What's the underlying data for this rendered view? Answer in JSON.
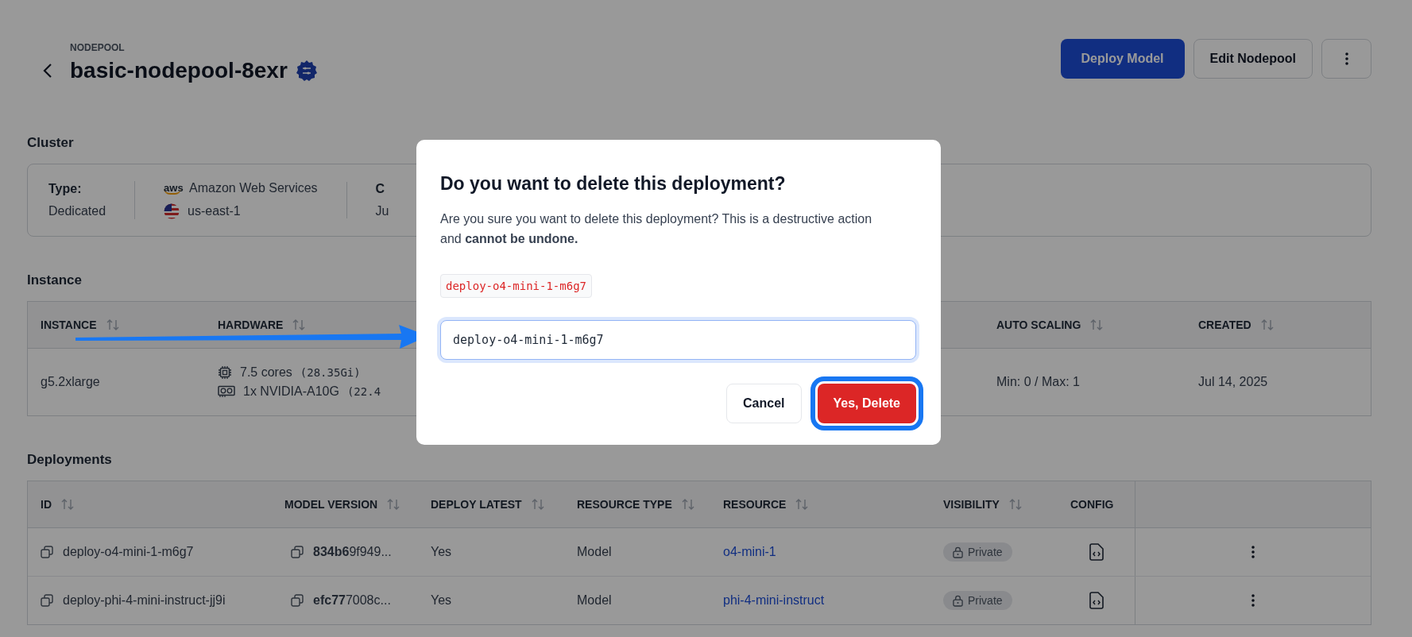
{
  "header": {
    "eyebrow": "NODEPOOL",
    "title": "basic-nodepool-8exr",
    "buttons": [
      {
        "label": "Deploy Model",
        "kind": "primary"
      },
      {
        "label": "Edit Nodepool",
        "kind": "secondary"
      }
    ]
  },
  "cluster": {
    "heading": "Cluster",
    "type_label": "Type:",
    "type_value": "Dedicated",
    "provider_logo": "aws",
    "provider": "Amazon Web Services",
    "region": "us-east-1",
    "column_3_label": "C",
    "column_3_value": "Ju"
  },
  "instance": {
    "heading": "Instance",
    "columns": [
      {
        "label": "INSTANCE",
        "sortable": true
      },
      {
        "label": "HARDWARE",
        "sortable": true
      },
      {
        "label": "AUTO SCALING",
        "sortable": true
      },
      {
        "label": "CREATED",
        "sortable": true
      }
    ],
    "rows": [
      {
        "instance": "g5.2xlarge",
        "cpu": "7.5 cores",
        "cpu_detail": "(28.35Gi)",
        "gpu": "1x NVIDIA-A10G",
        "gpu_detail": "(22.4",
        "auto_scaling": "Min: 0 / Max: 1",
        "created": "Jul 14, 2025"
      }
    ]
  },
  "deployments": {
    "heading": "Deployments",
    "columns": [
      {
        "label": "ID",
        "sortable": true
      },
      {
        "label": "MODEL VERSION",
        "sortable": true
      },
      {
        "label": "DEPLOY LATEST",
        "sortable": true
      },
      {
        "label": "RESOURCE TYPE",
        "sortable": true
      },
      {
        "label": "RESOURCE",
        "sortable": true
      },
      {
        "label": "VISIBILITY",
        "sortable": true
      },
      {
        "label": "CONFIG",
        "sortable": false
      }
    ],
    "rows": [
      {
        "id": "deploy-o4-mini-1-m6g7",
        "model_version": "**834b6**9f949...",
        "deploy_latest": "Yes",
        "resource_type": "Model",
        "resource": "o4-mini-1",
        "visibility": "Private"
      },
      {
        "id": "deploy-phi-4-mini-instruct-jj9i",
        "model_version": "**efc77**7008c...",
        "deploy_latest": "Yes",
        "resource_type": "Model",
        "resource": "phi-4-mini-instruct",
        "visibility": "Private"
      }
    ]
  },
  "dialog": {
    "title": "Do you want to delete this deployment?",
    "message": "Are you sure you want to delete this deployment? This is a destructive action and **cannot be undone.**",
    "confirm_text": "deploy-o4-mini-1-m6g7",
    "input": {
      "value": "deploy-o4-mini-1-m6g7",
      "focused": true
    },
    "cancel_button": "Cancel",
    "confirm_button": {
      "label": "Yes, Delete",
      "focused": true
    }
  }
}
